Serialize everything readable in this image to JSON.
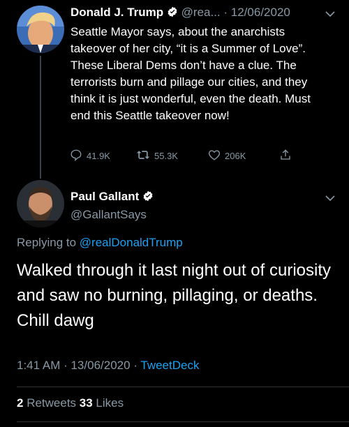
{
  "tweet1": {
    "name": "Donald J. Trump",
    "handle": "@rea...",
    "date": "· 12/06/2020",
    "text": "Seattle Mayor says, about the anarchists takeover of her city, “it is a Summer of Love”. These Liberal Dems don’t have a clue. The terrorists burn and pillage our cities, and they think it is just wonderful, even the death. Must end this Seattle takeover now!",
    "replies": "41.9K",
    "retweets": "55.3K",
    "likes": "206K"
  },
  "tweet2": {
    "name": "Paul Gallant",
    "handle": "@GallantSays",
    "replying_prefix": "Replying to ",
    "replying_to": "@realDonaldTrump",
    "text": "Walked through it last night out of curiosity and saw no burning, pillaging, or deaths. Chill dawg",
    "time": "1:41 AM · 13/06/2020 · ",
    "source": "TweetDeck",
    "retweets_count": "2",
    "retweets_label": " Retweets ",
    "likes_count": "33",
    "likes_label": " Likes"
  },
  "colors": {
    "background": "#000000",
    "muted": "#8899a6",
    "link": "#1da1f2",
    "verified": "#ffffff"
  },
  "icons": [
    "verified-badge-icon",
    "chevron-down-icon",
    "reply-icon",
    "retweet-icon",
    "like-icon",
    "share-icon"
  ]
}
